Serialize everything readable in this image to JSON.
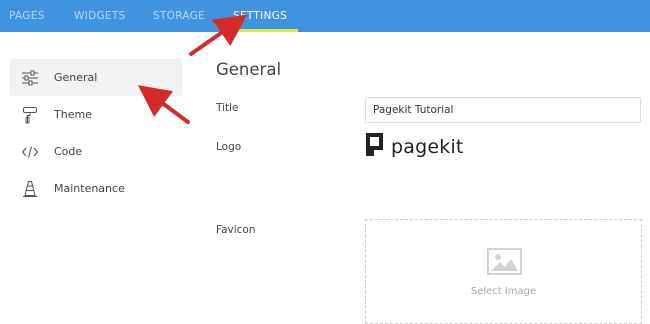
{
  "topnav": {
    "items": [
      {
        "label": "PAGES"
      },
      {
        "label": "WIDGETS"
      },
      {
        "label": "STORAGE"
      },
      {
        "label": "SETTINGS"
      }
    ],
    "active_color": "#ffffff",
    "bar_color": "#3f93df",
    "underline_color": "#d4ee3c"
  },
  "sidebar": {
    "items": [
      {
        "label": "General",
        "icon": "sliders-icon",
        "active": true
      },
      {
        "label": "Theme",
        "icon": "paint-roller-icon"
      },
      {
        "label": "Code",
        "icon": "code-icon"
      },
      {
        "label": "Maintenance",
        "icon": "traffic-cone-icon"
      }
    ]
  },
  "main": {
    "section_title": "General",
    "title_label": "Title",
    "title_value": "Pagekit Tutorial",
    "logo_label": "Logo",
    "logo_text": "pagekit",
    "favicon_label": "Favicon",
    "favicon_select_label": "Select Image"
  },
  "annotations": {
    "arrow_color": "#d42a2a"
  }
}
